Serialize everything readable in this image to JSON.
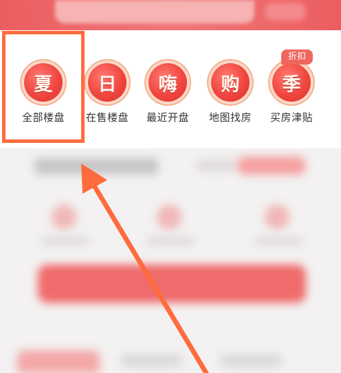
{
  "nav": {
    "items": [
      {
        "glyph": "夏",
        "label": "全部楼盘"
      },
      {
        "glyph": "日",
        "label": "在售楼盘"
      },
      {
        "glyph": "嗨",
        "label": "最近开盘"
      },
      {
        "glyph": "购",
        "label": "地图找房"
      },
      {
        "glyph": "季",
        "label": "买房津贴"
      }
    ],
    "badge": "折扣"
  },
  "colors": {
    "brand": "#ec5d5f",
    "highlight": "#ff6b3d",
    "arrow": "#ff6b3d"
  }
}
